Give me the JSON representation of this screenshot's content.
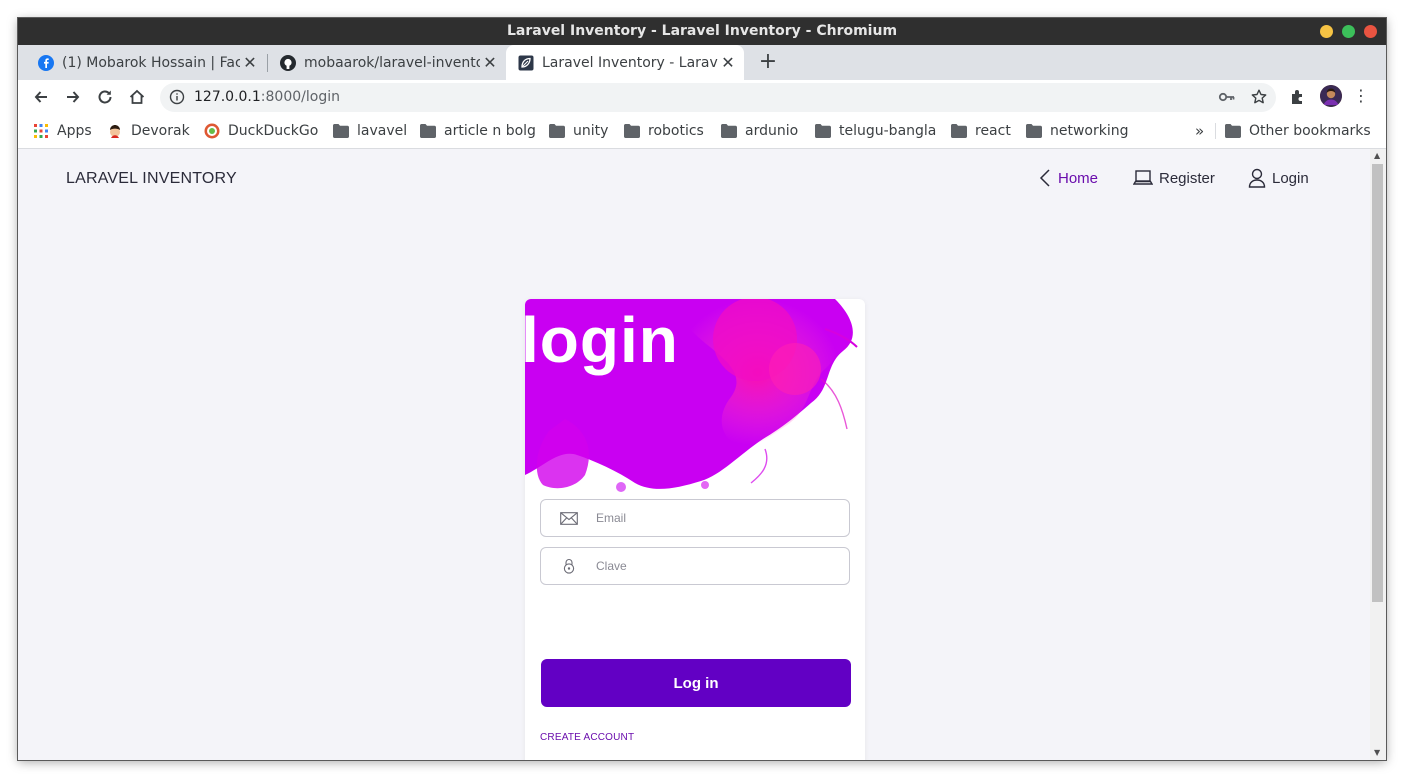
{
  "window": {
    "title": "Laravel Inventory - Laravel Inventory - Chromium"
  },
  "tabs": [
    {
      "label": "(1) Mobarok Hossain | Fac",
      "icon": "facebook-icon",
      "active": false
    },
    {
      "label": "mobaarok/laravel-invento",
      "icon": "github-icon",
      "active": false
    },
    {
      "label": "Laravel Inventory - Laravel",
      "icon": "leaf-icon",
      "active": true
    }
  ],
  "toolbar": {
    "url_host": "127.0.0.1",
    "url_path": ":8000/login"
  },
  "bookmarks": {
    "items": [
      {
        "label": "Apps",
        "icon": "apps-grid-icon"
      },
      {
        "label": "Devorak",
        "icon": "avatar-icon"
      },
      {
        "label": "DuckDuckGo",
        "icon": "duckduckgo-icon"
      },
      {
        "label": "lavavel",
        "icon": "folder-icon"
      },
      {
        "label": "article n bolg",
        "icon": "folder-icon"
      },
      {
        "label": "unity",
        "icon": "folder-icon"
      },
      {
        "label": "robotics",
        "icon": "folder-icon"
      },
      {
        "label": "ardunio",
        "icon": "folder-icon"
      },
      {
        "label": "telugu-bangla",
        "icon": "folder-icon"
      },
      {
        "label": "react",
        "icon": "folder-icon"
      },
      {
        "label": "networking",
        "icon": "folder-icon"
      }
    ],
    "overflow": "»",
    "other": "Other bookmarks"
  },
  "nav": {
    "brand": "LARAVEL INVENTORY",
    "home": "Home",
    "register": "Register",
    "login": "Login"
  },
  "card": {
    "hero_title": "login",
    "email_placeholder": "Email",
    "password_placeholder": "Clave",
    "submit": "Log in",
    "create_account": "CREATE ACCOUNT"
  },
  "colors": {
    "accent": "#6200c4",
    "link": "#6a0dad",
    "page_bg": "#f4f4f9"
  }
}
